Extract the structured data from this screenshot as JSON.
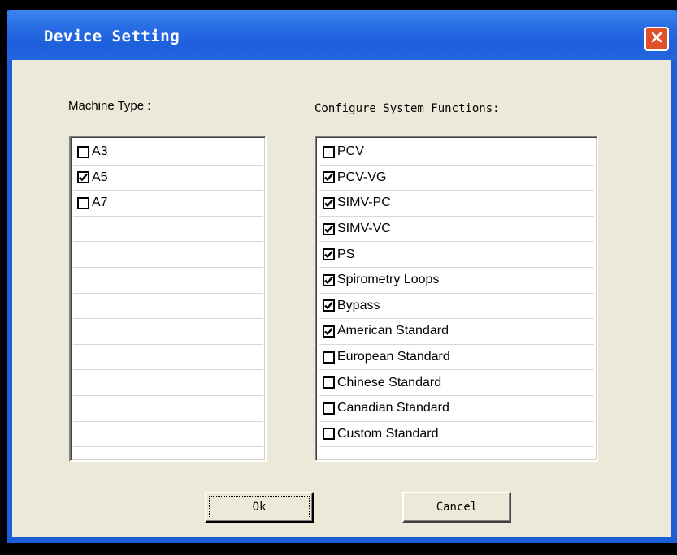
{
  "window": {
    "title": "Device Setting"
  },
  "machine": {
    "label": "Machine Type :",
    "items": [
      {
        "label": "A3",
        "checked": false
      },
      {
        "label": "A5",
        "checked": true
      },
      {
        "label": "A7",
        "checked": false
      }
    ]
  },
  "config": {
    "label": "Configure System Functions:",
    "items": [
      {
        "label": "PCV",
        "checked": false
      },
      {
        "label": "PCV-VG",
        "checked": true
      },
      {
        "label": "SIMV-PC",
        "checked": true
      },
      {
        "label": "SIMV-VC",
        "checked": true
      },
      {
        "label": "PS",
        "checked": true
      },
      {
        "label": "Spirometry Loops",
        "checked": true
      },
      {
        "label": "Bypass",
        "checked": true
      },
      {
        "label": "American Standard",
        "checked": true
      },
      {
        "label": "European Standard",
        "checked": false
      },
      {
        "label": "Chinese Standard",
        "checked": false
      },
      {
        "label": "Canadian Standard",
        "checked": false
      },
      {
        "label": "Custom Standard",
        "checked": false
      }
    ]
  },
  "buttons": {
    "ok": "Ok",
    "cancel": "Cancel"
  },
  "icons": {
    "close": "close-icon",
    "check": "checkmark-icon"
  },
  "colors": {
    "titlebar": "#2a6fe6",
    "close": "#e0502a",
    "dialog_bg": "#ece9d8"
  }
}
